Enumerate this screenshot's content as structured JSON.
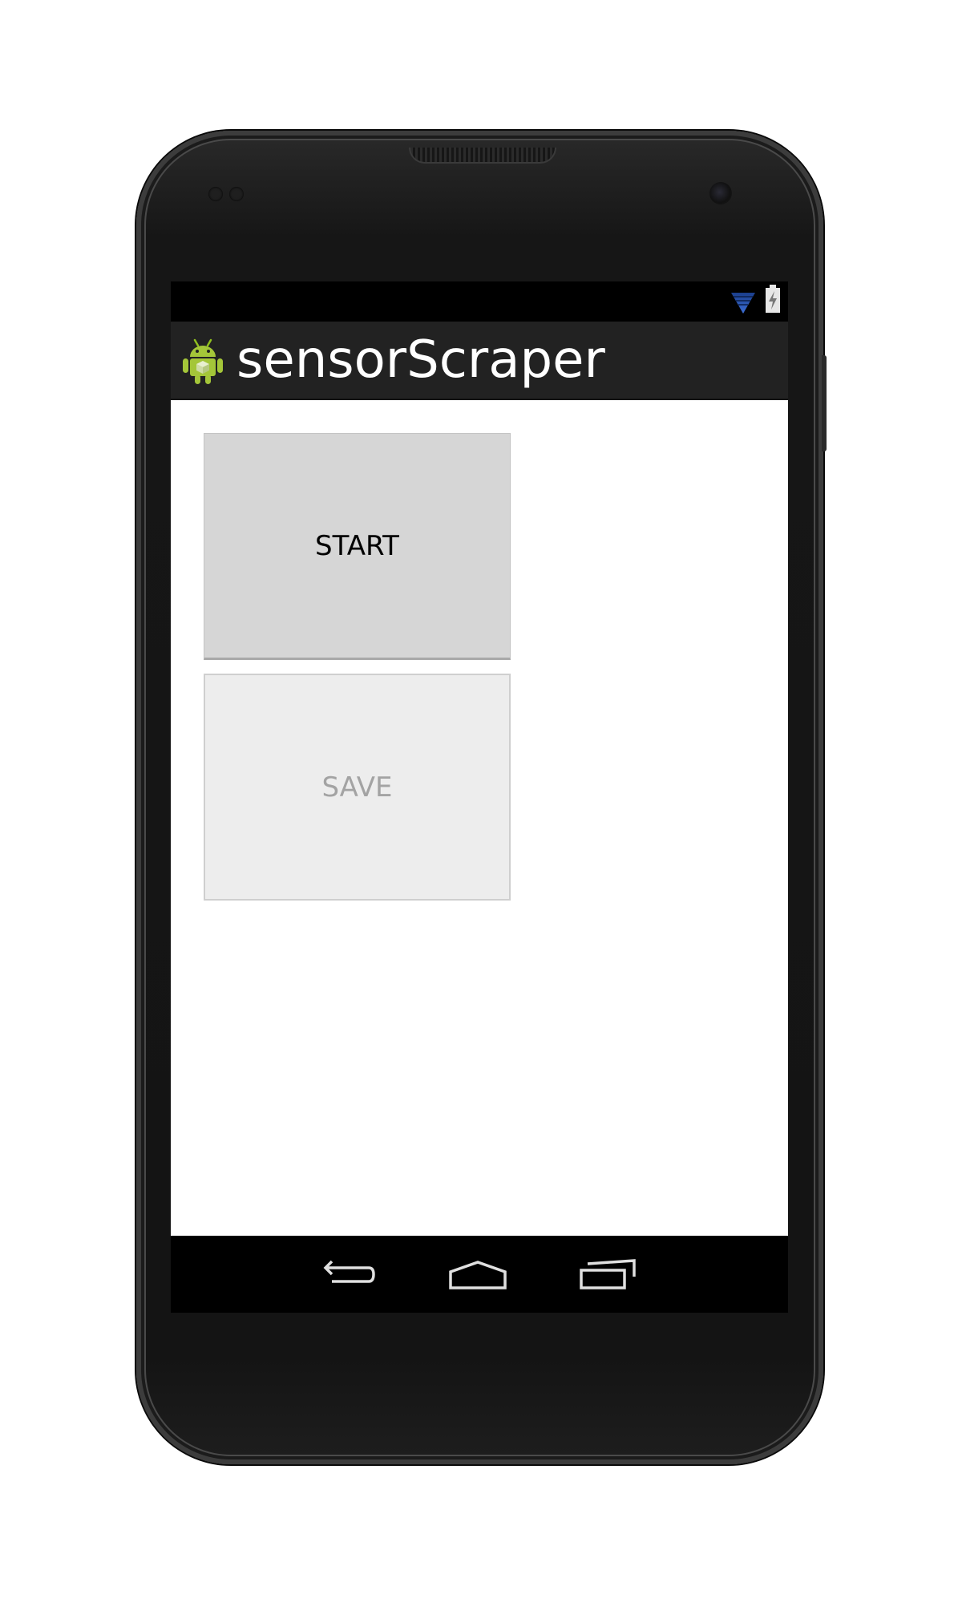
{
  "status_bar": {
    "wifi_icon": "wifi-icon",
    "battery_icon": "battery-charging-icon",
    "wifi_color": "#33b5e5"
  },
  "action_bar": {
    "app_icon": "android-robot-icon",
    "title": "sensorScraper"
  },
  "main": {
    "start_button": {
      "label": "START",
      "enabled": true
    },
    "save_button": {
      "label": "SAVE",
      "enabled": false
    }
  },
  "navigation_bar": {
    "back_icon": "back-icon",
    "home_icon": "home-icon",
    "recents_icon": "recent-apps-icon"
  },
  "colors": {
    "action_bar": "#222222",
    "start_button_bg": "#d6d6d6",
    "save_button_bg": "#ededed",
    "disabled_text": "#a3a3a3"
  }
}
